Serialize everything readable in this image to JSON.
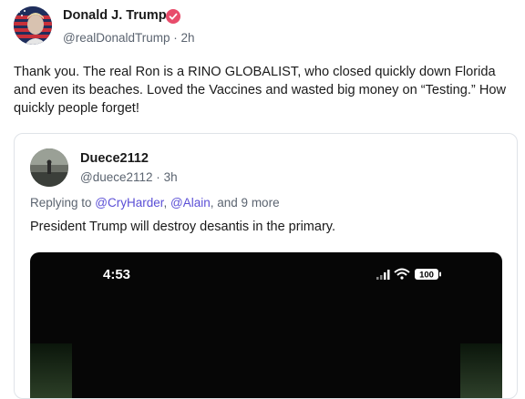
{
  "post": {
    "author": "Donald J. Trump",
    "handle": "@realDonaldTrump",
    "separator": "·",
    "time": "2h",
    "text": "Thank you. The real Ron is a RINO GLOBALIST, who closed quickly down Florida and even its beaches. Loved the Vaccines and wasted big money on “Testing.” How quickly people forget!",
    "verified_color": "#e84c6b"
  },
  "quote": {
    "author": "Duece2112",
    "handle": "@duece2112",
    "separator": "·",
    "time": "3h",
    "replying_prefix": "Replying to ",
    "mention_1": "@CryHarder",
    "comma": ", ",
    "mention_2": "@Alain",
    "more": ", and 9 more",
    "text": "President Trump will destroy desantis in the primary.",
    "media": {
      "time": "4:53",
      "battery": "100"
    }
  }
}
